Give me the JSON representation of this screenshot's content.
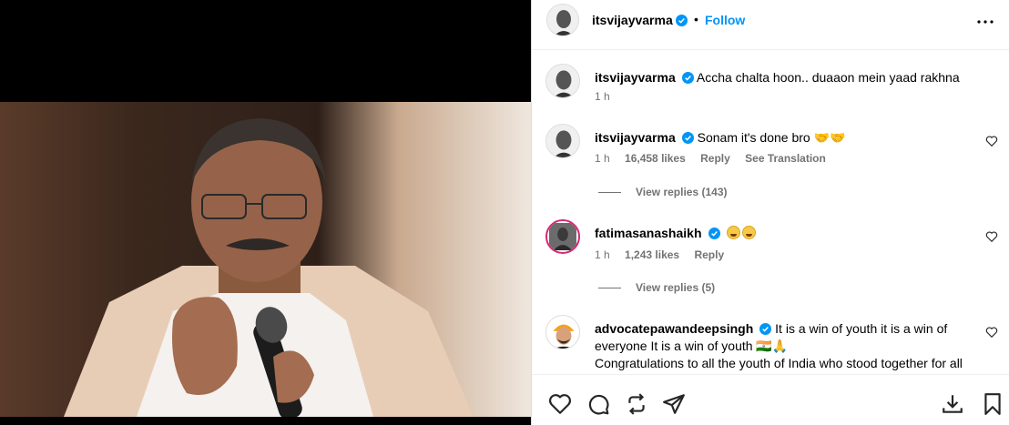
{
  "post": {
    "author": "itsvijayvarma",
    "follow_label": "Follow",
    "separator": "•"
  },
  "comments": [
    {
      "username": "itsvijayvarma",
      "text": "Accha chalta hoon.. duaaon mein yaad rakhna",
      "time": "1 h"
    },
    {
      "username": "itsvijayvarma",
      "text": "Sonam it's done bro 🤝🤝",
      "time": "1 h",
      "likes": "16,458 likes",
      "reply": "Reply",
      "translate": "See Translation",
      "view_replies": "View replies (143)"
    },
    {
      "username": "fatimasanashaikh",
      "text": "",
      "emojis": [
        "joy-emoji",
        "joy-emoji"
      ],
      "time": "1 h",
      "likes": "1,243 likes",
      "reply": "Reply",
      "view_replies": "View replies (5)"
    },
    {
      "username": "advocatepawandeepsingh",
      "text": "It is a win of youth it is a win of everyone It is a win of youth 🇮🇳🙏",
      "text2": "Congratulations to all the youth of India who stood together for all this..."
    }
  ],
  "icons": {
    "verified": "verified-badge-icon",
    "more": "more-options-icon",
    "like": "heart-icon",
    "comment": "comment-icon",
    "repost": "repost-icon",
    "share": "share-icon",
    "save": "bookmark-icon",
    "download": "download-icon"
  },
  "colors": {
    "accent": "#0095f6",
    "muted": "#737373",
    "verified": "#0095f6"
  }
}
